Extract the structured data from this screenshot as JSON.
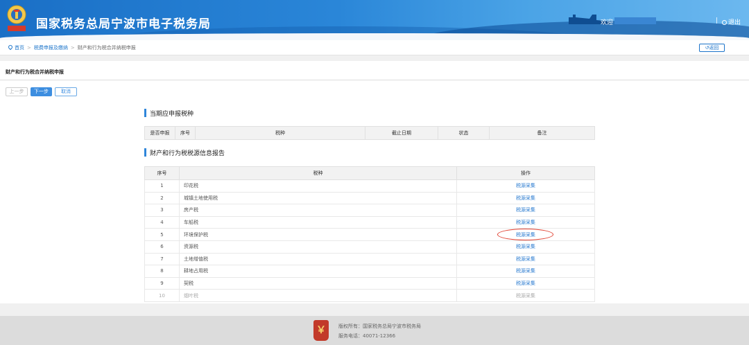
{
  "header": {
    "title": "国家税务总局宁波市电子税务局",
    "welcome": "欢迎",
    "separator": "|",
    "logout": "退出"
  },
  "breadcrumb": {
    "home": "首页",
    "level1": "税费申报及缴纳",
    "current": "财产和行为税合并纳税申报",
    "separator": ">",
    "back": "返回"
  },
  "tab": {
    "label": "财产和行为税合并纳税申报"
  },
  "buttons": {
    "prev": "上一步",
    "next": "下一步",
    "cancel": "取消"
  },
  "section1": {
    "title": "当期应申报税种",
    "headers": [
      "是否申报",
      "序号",
      "税种",
      "截止日期",
      "状态",
      "备注"
    ]
  },
  "section2": {
    "title": "财产和行为税税源信息报告",
    "headers": [
      "序号",
      "税种",
      "操作"
    ],
    "rows": [
      {
        "no": "1",
        "tax": "印花税",
        "action": "税源采集"
      },
      {
        "no": "2",
        "tax": "城镇土地使用税",
        "action": "税源采集"
      },
      {
        "no": "3",
        "tax": "房产税",
        "action": "税源采集"
      },
      {
        "no": "4",
        "tax": "车船税",
        "action": "税源采集"
      },
      {
        "no": "5",
        "tax": "环境保护税",
        "action": "税源采集"
      },
      {
        "no": "6",
        "tax": "资源税",
        "action": "税源采集"
      },
      {
        "no": "7",
        "tax": "土地增值税",
        "action": "税源采集"
      },
      {
        "no": "8",
        "tax": "耕地占用税",
        "action": "税源采集"
      },
      {
        "no": "9",
        "tax": "契税",
        "action": "税源采集"
      },
      {
        "no": "10",
        "tax": "烟叶税",
        "action": "税源采集"
      }
    ]
  },
  "footer": {
    "copyright": "版权所有：国家税务总局宁波市税务局",
    "phone": "服务电话：40071-12366"
  },
  "colors": {
    "accent": "#2a7bd0",
    "header": "#1a6fc6",
    "highlight": "#e04030"
  }
}
